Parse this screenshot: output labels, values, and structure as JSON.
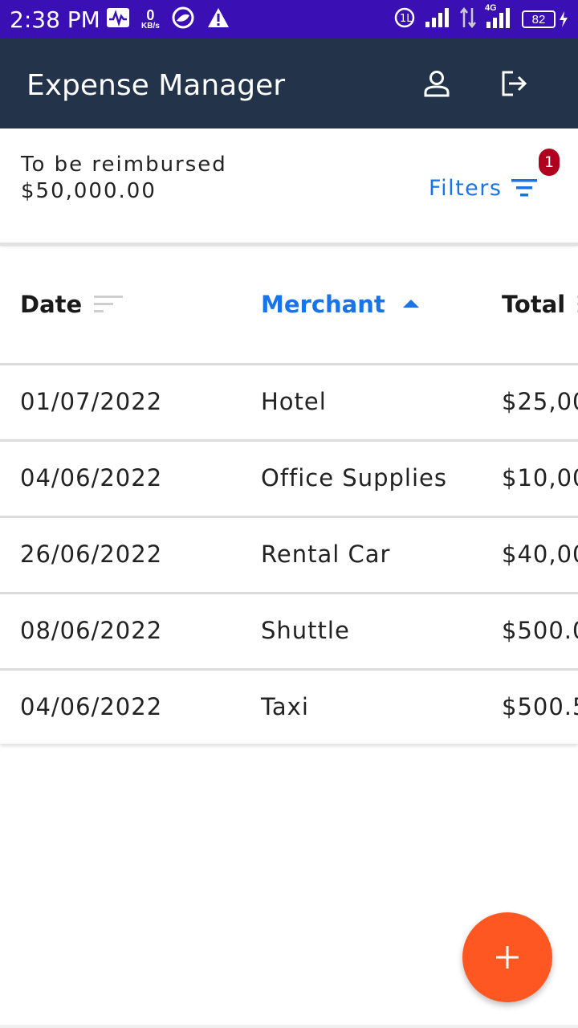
{
  "status_bar": {
    "time": "2:38 PM",
    "data_rate_value": "0",
    "data_rate_unit": "KB/s",
    "network_label": "4G",
    "battery": "82",
    "icons": [
      "activity-icon",
      "data-rate-icon",
      "browser-icon",
      "warning-icon",
      "volte-icon",
      "signal-icon",
      "data-transfer-icon",
      "signal-4g-icon",
      "battery-icon",
      "charging-icon"
    ]
  },
  "app_bar": {
    "title": "Expense Manager",
    "icons": [
      "account-icon",
      "logout-icon"
    ],
    "background": "#22334a"
  },
  "summary": {
    "label": "To be reimbursed",
    "amount": "$50,000.00",
    "filters_label": "Filters",
    "filters_badge": "1",
    "filter_icon": "filter-icon"
  },
  "table": {
    "columns": [
      {
        "label": "Date",
        "sort_icon": "sort-icon",
        "active": false
      },
      {
        "label": "Merchant",
        "sort_icon": "sort-ascending-icon",
        "active": true
      },
      {
        "label": "Total",
        "sort_icon": "sort-icon",
        "active": false
      }
    ],
    "rows": [
      {
        "date": "01/07/2022",
        "merchant": "Hotel",
        "total": "$25,00"
      },
      {
        "date": "04/06/2022",
        "merchant": "Office Supplies",
        "total": "$10,00"
      },
      {
        "date": "26/06/2022",
        "merchant": "Rental Car",
        "total": "$40,00"
      },
      {
        "date": "08/06/2022",
        "merchant": "Shuttle",
        "total": "$500.0"
      },
      {
        "date": "04/06/2022",
        "merchant": "Taxi",
        "total": "$500.5"
      }
    ]
  },
  "fab": {
    "icon": "add-icon"
  },
  "colors": {
    "status_bar": "#3a10b5",
    "accent": "#1a73e8",
    "badge": "#b00020",
    "fab": "#ff5722"
  }
}
